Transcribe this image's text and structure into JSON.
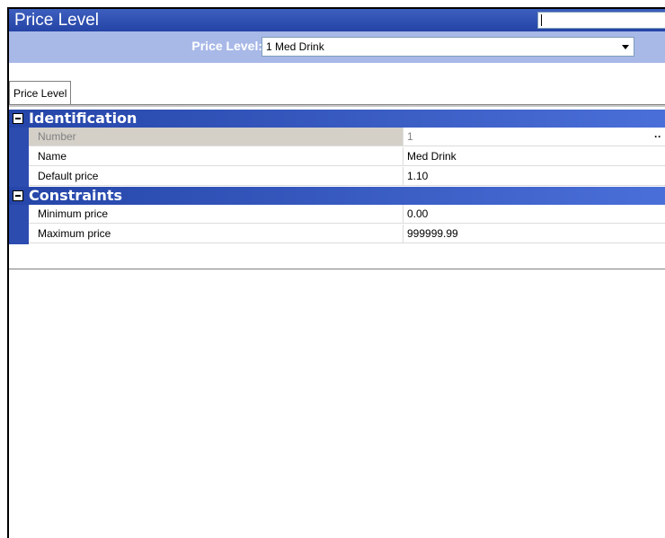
{
  "window": {
    "title": "Price Level",
    "search_value": ""
  },
  "selector": {
    "label": "Price Level:",
    "value": "1 Med Drink"
  },
  "tabs": [
    {
      "label": "Price Level"
    }
  ],
  "categories": [
    {
      "label": "Identification",
      "rows": [
        {
          "name": "Number",
          "value": "1",
          "disabled": true
        },
        {
          "name": "Name",
          "value": "Med Drink"
        },
        {
          "name": "Default price",
          "value": "1.10"
        }
      ]
    },
    {
      "label": "Constraints",
      "rows": [
        {
          "name": "Minimum price",
          "value": "0.00"
        },
        {
          "name": "Maximum price",
          "value": "999999.99"
        }
      ]
    }
  ],
  "colors": {
    "titlebar": "#2d4cb0",
    "selectorbar": "#a8b9e8",
    "category": "#2545a8"
  }
}
